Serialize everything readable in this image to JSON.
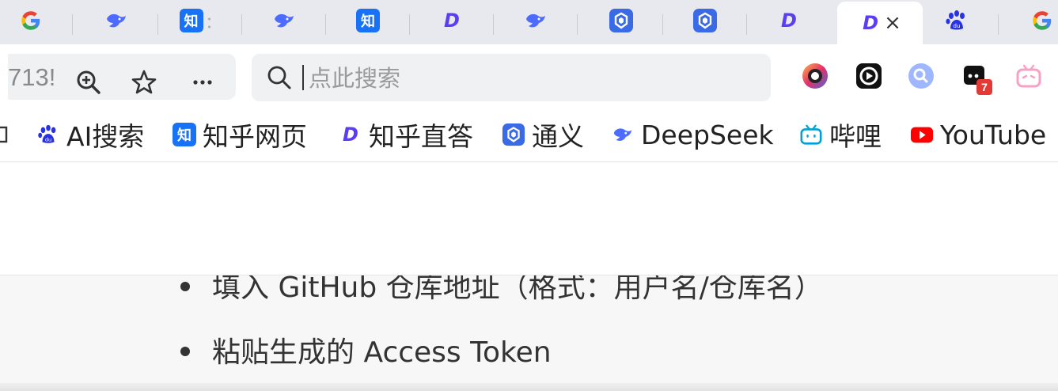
{
  "tabs": [
    {
      "site": "Google",
      "icon": "google-icon",
      "title": ""
    },
    {
      "site": "DeepSeek",
      "icon": "deepseek-whale-icon",
      "title": ""
    },
    {
      "site": "知乎",
      "icon": "zhihu-icon",
      "title": "知",
      "truncated_text": "：",
      "glyph": "知"
    },
    {
      "site": "DeepSeek",
      "icon": "deepseek-whale-icon",
      "title": ""
    },
    {
      "site": "知乎",
      "icon": "zhihu-icon",
      "title": "",
      "glyph": "知"
    },
    {
      "site": "知乎直答",
      "icon": "zhida-icon",
      "title": "",
      "glyph": "D"
    },
    {
      "site": "DeepSeek",
      "icon": "deepseek-whale-icon",
      "title": ""
    },
    {
      "site": "通义",
      "icon": "tongyi-icon",
      "title": ""
    },
    {
      "site": "通义",
      "icon": "tongyi-icon",
      "title": ""
    },
    {
      "site": "知乎直答",
      "icon": "zhida-icon",
      "title": "",
      "glyph": "D"
    },
    {
      "site": "知乎直答",
      "icon": "zhida-icon",
      "title": "",
      "glyph": "D",
      "active": true,
      "close": "×"
    },
    {
      "site": "百度",
      "icon": "baidu-paw-icon",
      "title": ""
    },
    {
      "site": "Google",
      "icon": "google-icon",
      "title": ""
    }
  ],
  "toolbar": {
    "url_fragment": "713!",
    "search_placeholder": "点此搜索",
    "extension_badge": "7"
  },
  "bookmarks": [
    {
      "label": "",
      "icon": "truncated-icon"
    },
    {
      "label": "AI搜索",
      "icon": "baidu-paw-icon"
    },
    {
      "label": "知乎网页",
      "icon": "zhihu-icon",
      "glyph": "知"
    },
    {
      "label": "知乎直答",
      "icon": "zhida-icon",
      "glyph": "D"
    },
    {
      "label": "通义",
      "icon": "tongyi-icon"
    },
    {
      "label": "DeepSeek",
      "icon": "deepseek-whale-icon"
    },
    {
      "label": "哔哩",
      "icon": "bilibili-tv-icon"
    },
    {
      "label": "YouTube",
      "icon": "youtube-icon"
    }
  ],
  "page": {
    "list": [
      "填入 GitHub 仓库地址（格式：用户名/仓库名）",
      "粘贴生成的 Access Token"
    ]
  },
  "colors": {
    "zhihu": "#1772f6",
    "zhida": "#5b3df5",
    "tongyi": "#3b6ae6",
    "deepseek": "#4d6bfe",
    "baidu": "#2932e1",
    "bilibili": "#00a1d6",
    "youtube": "#ff0000",
    "badge": "#e53935"
  }
}
